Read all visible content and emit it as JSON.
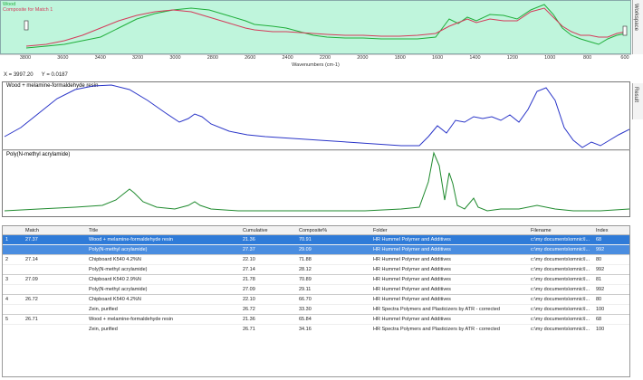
{
  "top_plot": {
    "legend": [
      {
        "label": "Wood",
        "color": "#1fae3a"
      },
      {
        "label": "Composite for Match 1",
        "color": "#d43a5a"
      }
    ],
    "x_ticks": [
      "3800",
      "3600",
      "3400",
      "3200",
      "3000",
      "2800",
      "2600",
      "2400",
      "2200",
      "2000",
      "1800",
      "1600",
      "1400",
      "1200",
      "1000",
      "800",
      "600"
    ],
    "x_label": "Wavenumbers (cm-1)"
  },
  "coords": {
    "x": "X = 3997.20",
    "y": "Y = 0.0187"
  },
  "side_tabs": {
    "workspace": "Workspace",
    "result": "Result"
  },
  "result_plot": {
    "title_top": "Wood + melamine-formaldehyde resin",
    "title_bottom": "Poly(N-methyl acrylamide)",
    "color_top": "#2a35c8",
    "color_bottom": "#1f8a2e"
  },
  "table": {
    "headers": [
      "",
      "Match",
      "Title",
      "Cumulative",
      "Composite%",
      "Folder",
      "Filename",
      "Index"
    ],
    "rows": [
      {
        "num": "1",
        "match": "27.37",
        "title": "Wood + melamine-formaldehyde resin",
        "cum": "21.36",
        "comp": "70.91",
        "folder": "HR Hummel Polymer and Additives",
        "file": "c:\\my documents\\omnic\\l...",
        "idx": "68",
        "cls": "sel grp"
      },
      {
        "num": "",
        "match": "",
        "title": "Poly(N-methyl acrylamide)",
        "cum": "27.37",
        "comp": "29.09",
        "folder": "HR Hummel Polymer and Additives",
        "file": "c:\\my documents\\omnic\\l...",
        "idx": "992",
        "cls": "sel2 sub"
      },
      {
        "num": "2",
        "match": "27.14",
        "title": "Chipboard K540 4.2%N",
        "cum": "22.10",
        "comp": "71.88",
        "folder": "HR Hummel Polymer and Additives",
        "file": "c:\\my documents\\omnic\\l...",
        "idx": "80",
        "cls": "grp"
      },
      {
        "num": "",
        "match": "",
        "title": "Poly(N-methyl acrylamide)",
        "cum": "27.14",
        "comp": "28.12",
        "folder": "HR Hummel Polymer and Additives",
        "file": "c:\\my documents\\omnic\\l...",
        "idx": "992",
        "cls": "sub"
      },
      {
        "num": "3",
        "match": "27.09",
        "title": "Chipboard K540 2.9%N",
        "cum": "21.78",
        "comp": "70.89",
        "folder": "HR Hummel Polymer and Additives",
        "file": "c:\\my documents\\omnic\\l...",
        "idx": "81",
        "cls": "grp"
      },
      {
        "num": "",
        "match": "",
        "title": "Poly(N-methyl acrylamide)",
        "cum": "27.09",
        "comp": "29.11",
        "folder": "HR Hummel Polymer and Additives",
        "file": "c:\\my documents\\omnic\\l...",
        "idx": "992",
        "cls": "sub"
      },
      {
        "num": "4",
        "match": "26.72",
        "title": "Chipboard K540 4.2%N",
        "cum": "22.10",
        "comp": "66.70",
        "folder": "HR Hummel Polymer and Additives",
        "file": "c:\\my documents\\omnic\\l...",
        "idx": "80",
        "cls": "grp"
      },
      {
        "num": "",
        "match": "",
        "title": "Zein, purified",
        "cum": "26.72",
        "comp": "33.30",
        "folder": "HR Spectra Polymers and Plasticizers by ATR - corrected",
        "file": "c:\\my documents\\omnic\\l...",
        "idx": "100",
        "cls": "sub"
      },
      {
        "num": "5",
        "match": "26.71",
        "title": "Wood + melamine-formaldehyde resin",
        "cum": "21.36",
        "comp": "65.84",
        "folder": "HR Hummel Polymer and Additives",
        "file": "c:\\my documents\\omnic\\l...",
        "idx": "68",
        "cls": "grp"
      },
      {
        "num": "",
        "match": "",
        "title": "Zein, purified",
        "cum": "26.71",
        "comp": "34.16",
        "folder": "HR Spectra Polymers and Plasticizers by ATR - corrected",
        "file": "c:\\my documents\\omnic\\l...",
        "idx": "100",
        "cls": "sub"
      }
    ]
  }
}
